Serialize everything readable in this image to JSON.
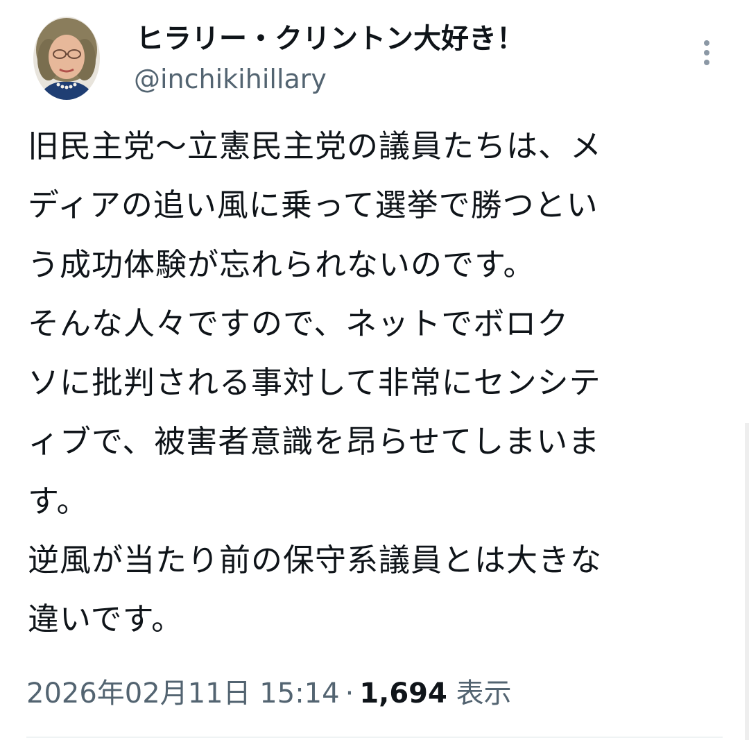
{
  "tweet": {
    "author": {
      "display_name": "ヒラリー・クリントン大好き！",
      "handle": "@inchikihillary",
      "avatar_icon": "avatar-portrait-illustration"
    },
    "more_icon": "more-vertical-icon",
    "text_lines": [
      "旧民主党〜立憲民主党の議員たちは、メ",
      "ディアの追い風に乗って選挙で勝つとい",
      "う成功体験が忘れられないのです。",
      "そんな人々ですので、ネットでボロク",
      "ソに批判される事対して非常にセンシテ",
      "ィブで、被害者意識を昂らせてしまいま",
      "す。",
      "逆風が当たり前の保守系議員とは大きな",
      "違いです。"
    ],
    "timestamp": "2026年02月11日 15:14",
    "separator": "·",
    "views_count": "1,694",
    "views_label": "表示"
  },
  "colors": {
    "text_primary": "#0f1419",
    "text_secondary": "#536471",
    "divider": "#eff3f4"
  }
}
